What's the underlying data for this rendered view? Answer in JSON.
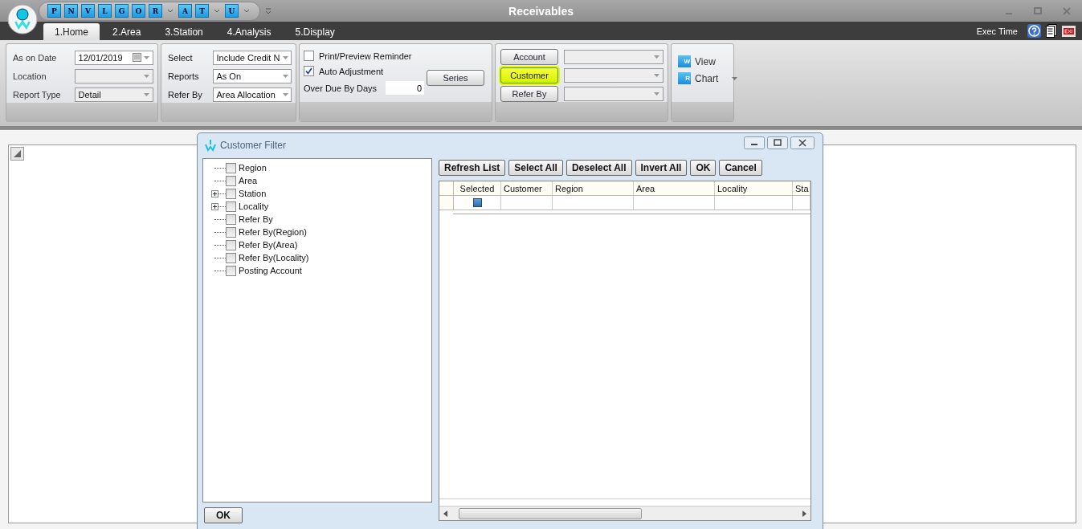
{
  "window": {
    "title": "Receivables"
  },
  "quick_access": [
    {
      "label": "P",
      "menu": false
    },
    {
      "label": "N",
      "menu": false
    },
    {
      "label": "V",
      "menu": false
    },
    {
      "label": "L",
      "menu": false
    },
    {
      "label": "G",
      "menu": false
    },
    {
      "label": "O",
      "menu": false
    },
    {
      "label": "R",
      "menu": true
    },
    {
      "label": "A",
      "menu": false
    },
    {
      "label": "T",
      "menu": true
    },
    {
      "label": "U",
      "menu": true
    }
  ],
  "tabs": [
    {
      "label": "1.Home",
      "selected": true
    },
    {
      "label": "2.Area",
      "selected": false
    },
    {
      "label": "3.Station",
      "selected": false
    },
    {
      "label": "4.Analysis",
      "selected": false
    },
    {
      "label": "5.Display",
      "selected": false
    }
  ],
  "exec_time": "Exec Time",
  "group1": [
    {
      "label": "As on Date",
      "value": "12/01/2019",
      "kind": "date"
    },
    {
      "label": "Location",
      "kind": "combo"
    },
    {
      "label": "Report Type",
      "value": "Detail",
      "kind": "combo"
    }
  ],
  "group2": [
    {
      "label": "Select",
      "value": "Include Credit N"
    },
    {
      "label": "Reports",
      "value": "As On"
    },
    {
      "label": "Refer By",
      "value": "Area Allocation"
    }
  ],
  "group3": {
    "checks": [
      {
        "label": "Print/Preview Reminder",
        "checked": false
      },
      {
        "label": "Auto Adjustment",
        "checked": true
      }
    ],
    "series_button": "Series",
    "days_label": "Over Due By Days",
    "days_value": "0"
  },
  "group4": [
    {
      "label": "Account",
      "selected": false
    },
    {
      "label": "Customer",
      "selected": true
    },
    {
      "label": "Refer By",
      "selected": false
    }
  ],
  "group5": [
    {
      "label": "View",
      "icon": "W",
      "menu": false
    },
    {
      "label": "Chart",
      "icon": "R",
      "menu": true
    }
  ],
  "dialog": {
    "title": "Customer Filter",
    "tree": [
      {
        "label": "Region",
        "checked": false,
        "expandable": false
      },
      {
        "label": "Area",
        "checked": false,
        "expandable": false
      },
      {
        "label": "Station",
        "checked": false,
        "expandable": true
      },
      {
        "label": "Locality",
        "checked": false,
        "expandable": true
      },
      {
        "label": "Refer By",
        "checked": false,
        "expandable": false
      },
      {
        "label": "Refer By(Region)",
        "checked": false,
        "expandable": false
      },
      {
        "label": "Refer By(Area)",
        "checked": false,
        "expandable": false
      },
      {
        "label": "Refer By(Locality)",
        "checked": false,
        "expandable": false
      },
      {
        "label": "Posting Account",
        "checked": false,
        "expandable": false
      }
    ],
    "buttons": [
      "Refresh List",
      "Select All",
      "Deselect All",
      "Invert All",
      "OK",
      "Cancel"
    ],
    "columns": [
      "Selected",
      "Customer",
      "Region",
      "Area",
      "Locality",
      "Sta"
    ],
    "rows": [
      {
        "checked": true
      }
    ],
    "ok_button": "OK"
  }
}
